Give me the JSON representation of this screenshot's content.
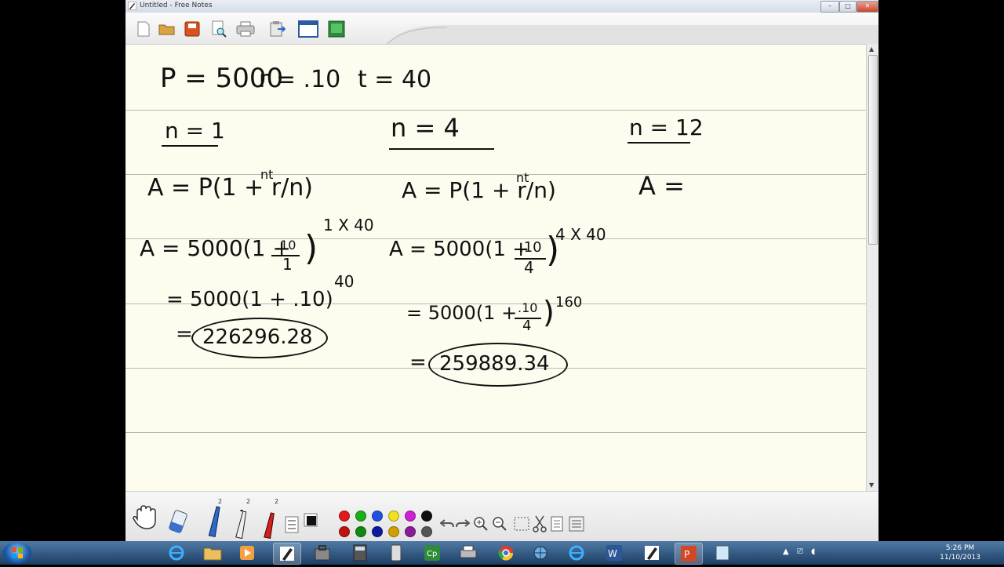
{
  "window": {
    "title": "Untitled - Free Notes",
    "min": "–",
    "max": "□",
    "close": "✕"
  },
  "toolbar": {
    "icons": [
      "new-file-icon",
      "open-folder-icon",
      "save-icon",
      "print-preview-icon",
      "print-icon",
      "clipboard-icon",
      "window-icon",
      "screen-icon"
    ]
  },
  "notes": {
    "given": {
      "P": "P = 5000",
      "r": "r = .10",
      "t": "t = 40"
    },
    "col1": {
      "header": "n = 1",
      "formula": "A = P(1 + r/n)",
      "formula_exp": "nt",
      "sub_pre": "A = 5000(1 +",
      "sub_num": ".10",
      "sub_den": "1",
      "sub_close": ")",
      "sub_exp": "1 X 40",
      "simp": "= 5000(1 + .10)",
      "simp_exp": "40",
      "eq": "=",
      "result": "226296.28"
    },
    "col2": {
      "header": "n = 4",
      "formula": "A = P(1 + r/n)",
      "formula_exp": "nt",
      "sub_pre": "A = 5000(1 +",
      "sub_num": ".10",
      "sub_den": "4",
      "sub_close": ")",
      "sub_exp": "4 X 40",
      "simp_pre": "= 5000(1 +",
      "simp_num": ".10",
      "simp_den": "4",
      "simp_close": ")",
      "simp_exp": "160",
      "eq": "=",
      "result": "259889.34"
    },
    "col3": {
      "header": "n = 12",
      "formula": "A ="
    }
  },
  "bottom": {
    "pen_counts": [
      "2",
      "2",
      "2"
    ],
    "colors": [
      "#e01a1a",
      "#19b019",
      "#2050e0",
      "#f0e020",
      "#d020d0",
      "#111111",
      "#c01010",
      "#118811",
      "#1018a0",
      "#d0a000",
      "#8a1a9a",
      "#555555"
    ]
  },
  "taskbar": {
    "time": "5:26 PM",
    "date": "11/10/2013"
  }
}
